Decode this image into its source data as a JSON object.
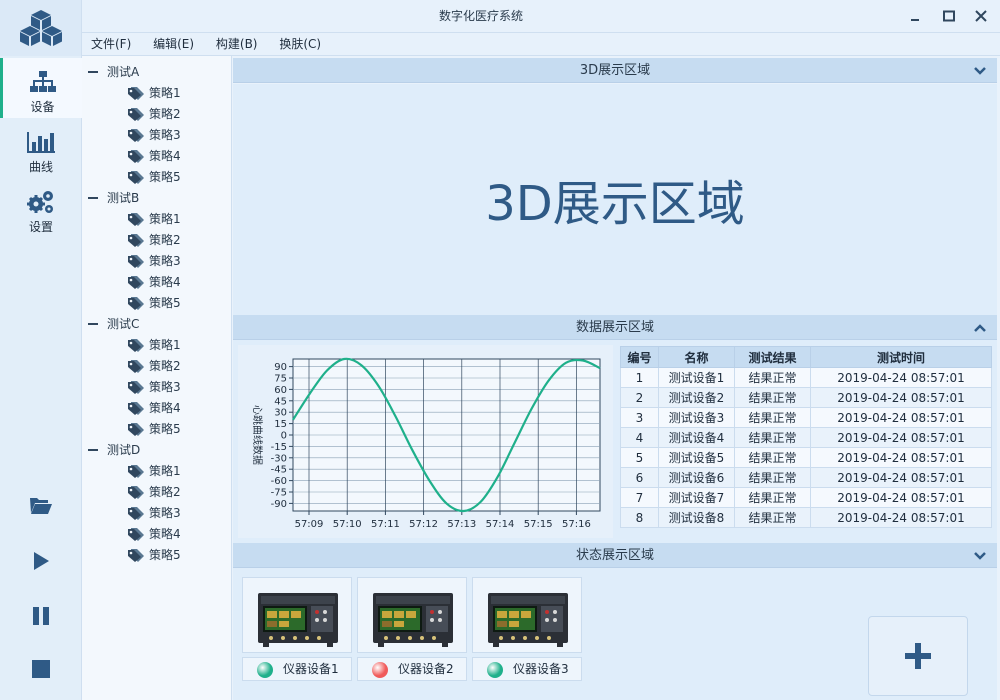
{
  "window": {
    "title": "数字化医疗系统",
    "logo_icon": "cubes-icon",
    "controls": [
      "minimize-icon",
      "maximize-icon",
      "close-icon"
    ]
  },
  "menu": [
    "文件(F)",
    "编辑(E)",
    "构建(B)",
    "换肤(C)"
  ],
  "nav": [
    {
      "label": "设备",
      "icon": "sitemap-icon",
      "active": true
    },
    {
      "label": "曲线",
      "icon": "bar-chart-icon",
      "active": false
    },
    {
      "label": "设置",
      "icon": "gears-icon",
      "active": false
    }
  ],
  "controls": [
    "folder-open-icon",
    "play-icon",
    "pause-icon",
    "stop-icon"
  ],
  "tree": [
    {
      "label": "测试A",
      "children": [
        "策略1",
        "策略2",
        "策略3",
        "策略4",
        "策略5"
      ]
    },
    {
      "label": "测试B",
      "children": [
        "策略1",
        "策略2",
        "策略3",
        "策略4",
        "策略5"
      ]
    },
    {
      "label": "测试C",
      "children": [
        "策略1",
        "策略2",
        "策略3",
        "策略4",
        "策略5"
      ]
    },
    {
      "label": "测试D",
      "children": [
        "策略1",
        "策略2",
        "策略3",
        "策略4",
        "策略5"
      ]
    }
  ],
  "panels": {
    "view3d": {
      "header": "3D展示区域",
      "content": "3D展示区域",
      "chevron": "chevron-down-icon"
    },
    "data": {
      "header": "数据展示区域",
      "chevron": "chevron-up-icon"
    },
    "status": {
      "header": "状态展示区域",
      "chevron": "chevron-down-icon"
    }
  },
  "chart_data": {
    "type": "line",
    "title": "",
    "xlabel": "",
    "ylabel": "心跳曲线数据",
    "x_ticks": [
      "57:09",
      "57:10",
      "57:11",
      "57:12",
      "57:13",
      "57:14",
      "57:15",
      "57:16"
    ],
    "y_ticks": [
      90,
      75,
      60,
      45,
      30,
      15,
      0,
      -15,
      -30,
      -45,
      -60,
      -75,
      -90
    ],
    "ylim": [
      -100,
      100
    ],
    "grid": true,
    "color": "#1fb08b",
    "series": [
      {
        "values": [
          20,
          55,
          85,
          100,
          92,
          65,
          25,
          -20,
          -60,
          -90,
          -100,
          -88,
          -55,
          -10,
          35,
          72,
          95,
          98,
          88
        ]
      }
    ]
  },
  "table": {
    "columns": [
      "编号",
      "名称",
      "测试结果",
      "测试时间"
    ],
    "rows": [
      [
        "1",
        "测试设备1",
        "结果正常",
        "2019-04-24 08:57:01"
      ],
      [
        "2",
        "测试设备2",
        "结果正常",
        "2019-04-24 08:57:01"
      ],
      [
        "3",
        "测试设备3",
        "结果正常",
        "2019-04-24 08:57:01"
      ],
      [
        "4",
        "测试设备4",
        "结果正常",
        "2019-04-24 08:57:01"
      ],
      [
        "5",
        "测试设备5",
        "结果正常",
        "2019-04-24 08:57:01"
      ],
      [
        "6",
        "测试设备6",
        "结果正常",
        "2019-04-24 08:57:01"
      ],
      [
        "7",
        "测试设备7",
        "结果正常",
        "2019-04-24 08:57:01"
      ],
      [
        "8",
        "测试设备8",
        "结果正常",
        "2019-04-24 08:57:01"
      ]
    ]
  },
  "devices": [
    {
      "label": "仪器设备1",
      "status_color": "#1fb08b"
    },
    {
      "label": "仪器设备2",
      "status_color": "#f05a5a"
    },
    {
      "label": "仪器设备3",
      "status_color": "#1fb08b"
    }
  ],
  "add_button_icon": "plus-icon"
}
